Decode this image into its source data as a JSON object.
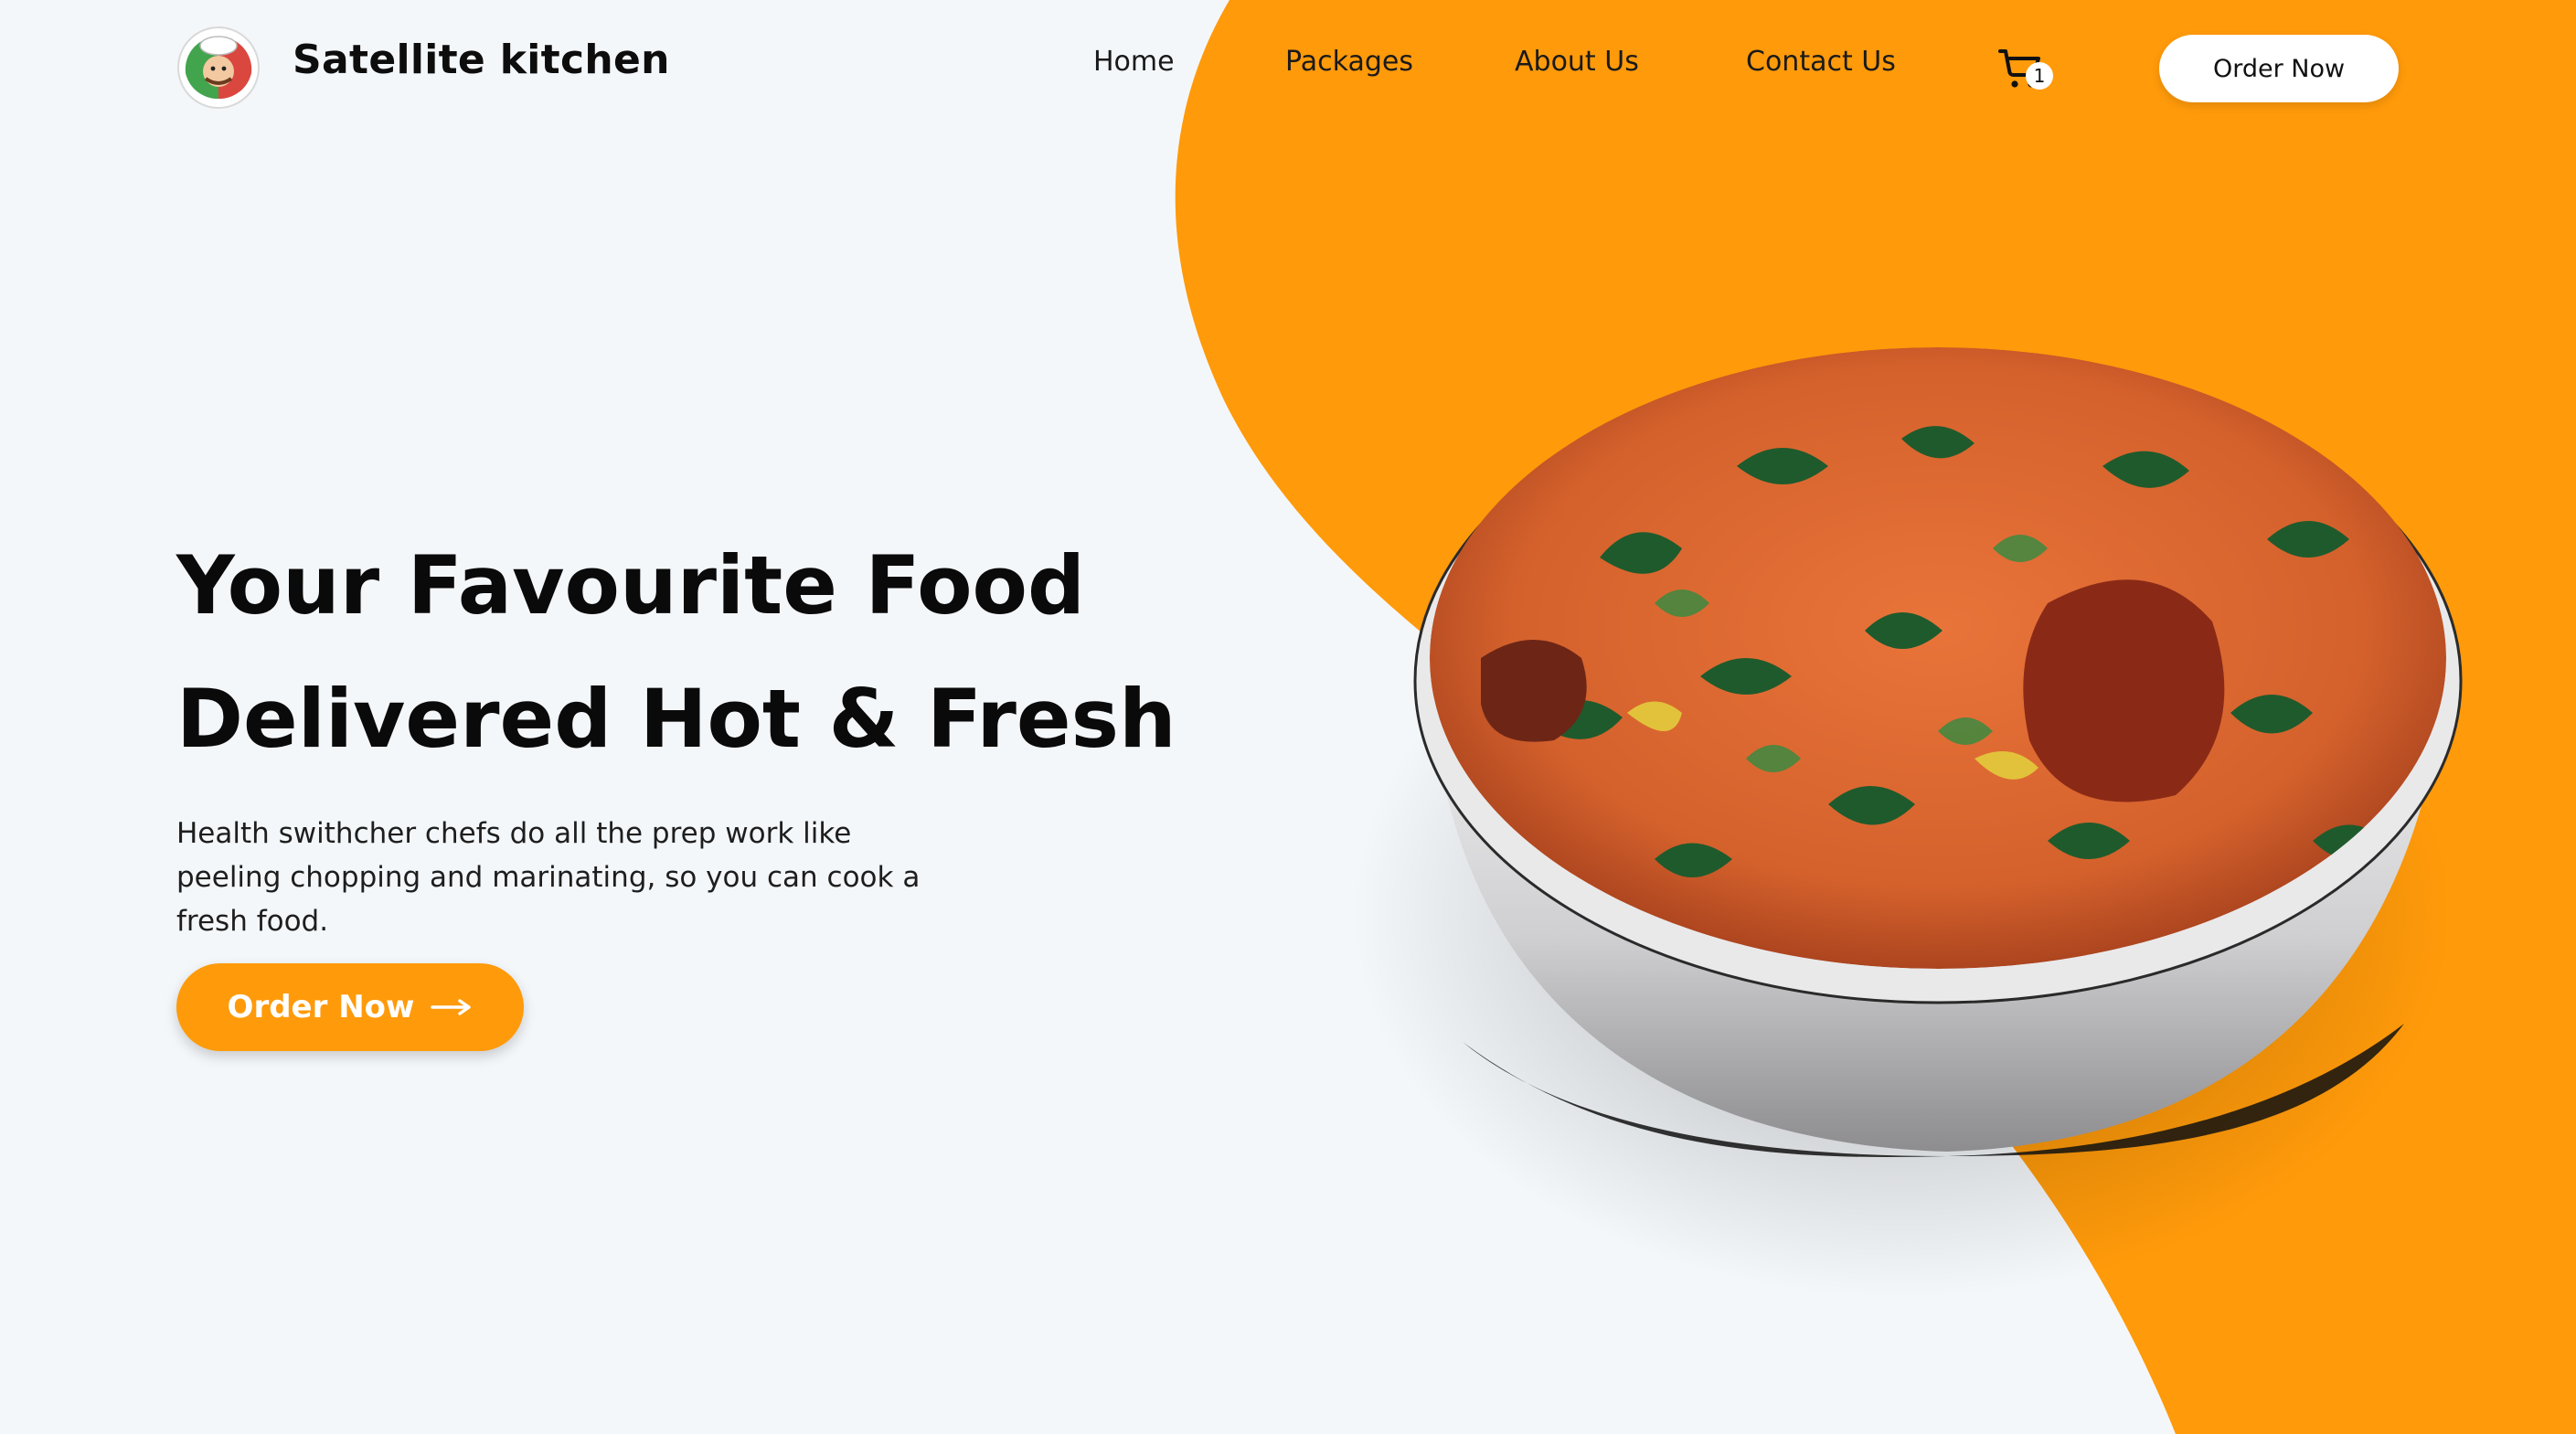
{
  "brand": {
    "name": "Satellite kitchen",
    "logo_icon": "chef-icon"
  },
  "nav": {
    "items": [
      {
        "label": "Home"
      },
      {
        "label": "Packages"
      },
      {
        "label": "About Us"
      },
      {
        "label": "Contact Us"
      }
    ],
    "cart_icon": "shopping-cart-icon",
    "cart_count": "1",
    "order_button": "Order Now"
  },
  "hero": {
    "title_line1": "Your Favourite Food",
    "title_line2": "Delivered Hot & Fresh",
    "description": "Health swithcher chefs do all the prep work like peeling chopping and marinating, so you can cook a fresh food.",
    "cta_label": "Order Now",
    "cta_icon": "arrow-right-icon",
    "image_icon": "food-bowl-image"
  },
  "colors": {
    "accent": "#ff9a0a",
    "background": "#f4f7fa",
    "text": "#0a0a0a",
    "bowl": "#d8d8da",
    "white": "#ffffff"
  }
}
